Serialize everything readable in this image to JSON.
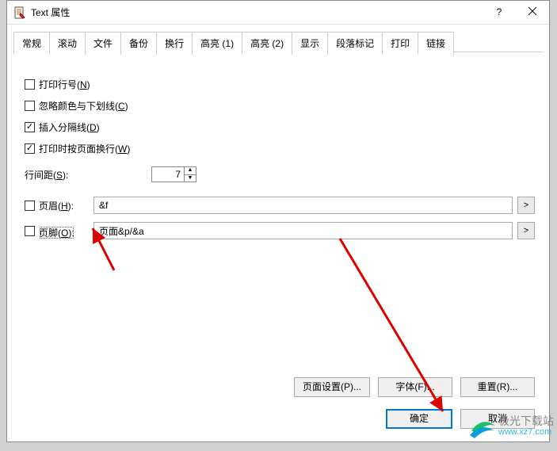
{
  "window": {
    "title": "Text 属性",
    "help_symbol": "?"
  },
  "tabs": {
    "items": [
      {
        "label": "常规"
      },
      {
        "label": "滚动"
      },
      {
        "label": "文件"
      },
      {
        "label": "备份"
      },
      {
        "label": "换行"
      },
      {
        "label": "高亮 (1)"
      },
      {
        "label": "高亮 (2)"
      },
      {
        "label": "显示"
      },
      {
        "label": "段落标记"
      },
      {
        "label": "打印"
      },
      {
        "label": "链接"
      }
    ],
    "active_index": 9
  },
  "print_tab": {
    "checkboxes": {
      "line_numbers": {
        "label_prefix": "打印行号(",
        "key": "N",
        "label_suffix": ")",
        "checked": false
      },
      "ignore_colors": {
        "label_prefix": "忽略颜色与下划线(",
        "key": "C",
        "label_suffix": ")",
        "checked": false
      },
      "insert_separator": {
        "label_prefix": "插入分隔线(",
        "key": "D",
        "label_suffix": ")",
        "checked": true
      },
      "wrap_pages": {
        "label_prefix": "打印时按页面换行(",
        "key": "W",
        "label_suffix": ")",
        "checked": true
      }
    },
    "line_spacing": {
      "label_prefix": "行间距(",
      "key": "S",
      "label_suffix": "):",
      "value": "7"
    },
    "header": {
      "label_prefix": "页眉(",
      "key": "H",
      "label_suffix": "):",
      "value": "&f",
      "checked": false,
      "goto": ">"
    },
    "footer": {
      "label_prefix": "页脚(",
      "key": "O",
      "label_suffix": "):",
      "value": "页面&p/&a",
      "checked": false,
      "goto": ">"
    }
  },
  "buttons": {
    "page_setup": "页面设置(P)...",
    "font": "字体(F)...",
    "reset": "重置(R)...",
    "ok": "确定",
    "cancel": "取消"
  },
  "watermark": {
    "name": "极光下载站",
    "url": "www.xz7.com"
  }
}
